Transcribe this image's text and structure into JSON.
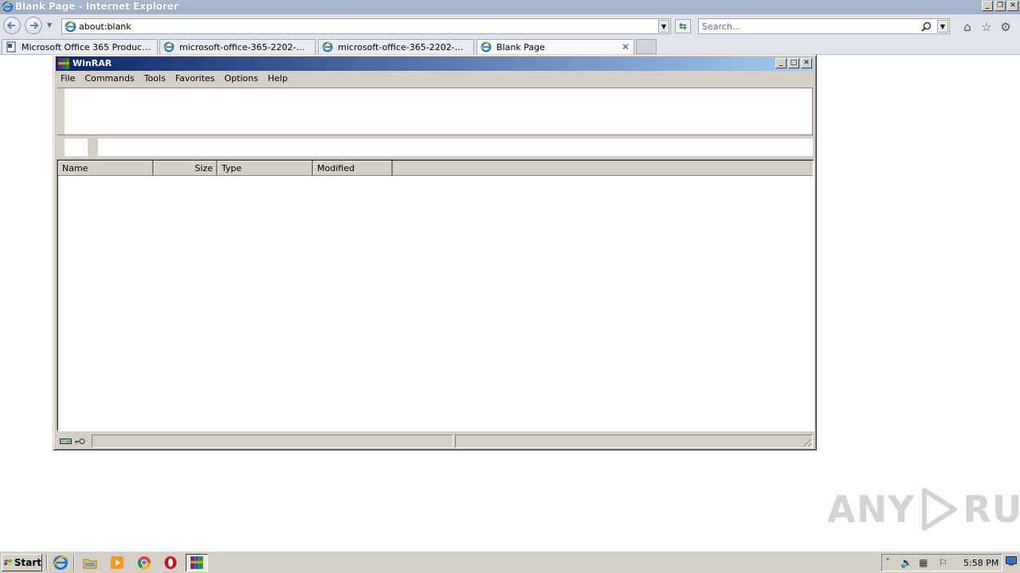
{
  "ie": {
    "window_title": "Blank Page - Internet Explorer",
    "address": "about:blank",
    "search_placeholder": "Search...",
    "tabs": [
      {
        "label": "Microsoft Office 365 Product Ke...",
        "icon": "document-icon"
      },
      {
        "label": "microsoft-office-365-2202-prod...",
        "icon": "ie-icon"
      },
      {
        "label": "microsoft-office-365-2202-prod...",
        "icon": "ie-icon"
      },
      {
        "label": "Blank Page",
        "icon": "ie-icon",
        "active": true
      }
    ]
  },
  "winrar": {
    "title": "WinRAR",
    "menu": [
      "File",
      "Commands",
      "Tools",
      "Favorites",
      "Options",
      "Help"
    ],
    "columns": [
      {
        "label": "Name"
      },
      {
        "label": "Size"
      },
      {
        "label": "Type"
      },
      {
        "label": "Modified"
      }
    ]
  },
  "taskbar": {
    "start_label": "Start",
    "clock": "5:58 PM",
    "apps": [
      "internet-explorer",
      "file-explorer",
      "media-player",
      "chrome",
      "opera",
      "winrar"
    ]
  },
  "watermark": {
    "left": "ANY",
    "right": "RUN"
  },
  "colors": {
    "winrar_titlebar_start": "#0a246a",
    "winrar_titlebar_end": "#a6caf0",
    "ie_chrome": "#dfe3ea",
    "window_face": "#d4d0c8"
  }
}
